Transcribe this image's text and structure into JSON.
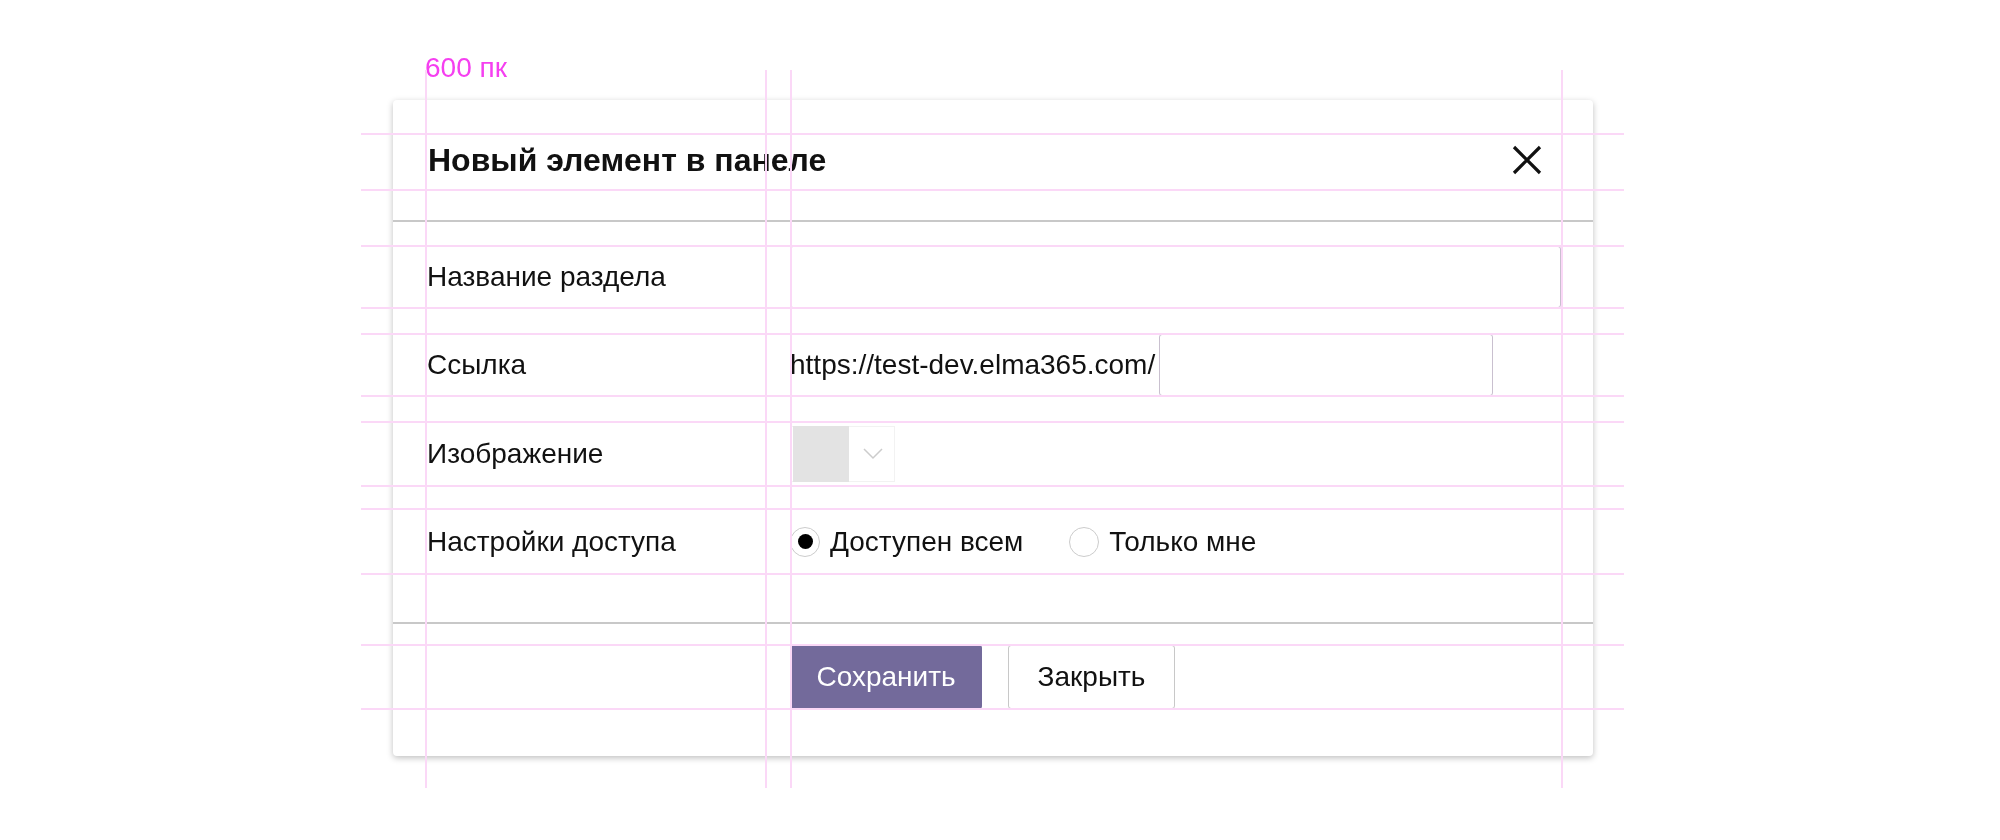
{
  "annotation": {
    "text": "600 пк"
  },
  "dialog": {
    "title": "Новый элемент в панеле",
    "fields": [
      {
        "kind": "text",
        "label": "Название раздела"
      },
      {
        "kind": "prefixed",
        "label": "Ссылка",
        "prefix": "https://test-dev.elma365.com/"
      },
      {
        "kind": "image",
        "label": "Изображение"
      },
      {
        "kind": "radio",
        "label": "Настройки доступа",
        "options": [
          {
            "label": "Доступен всем",
            "selected": true
          },
          {
            "label": "Только мне",
            "selected": false
          }
        ]
      }
    ],
    "buttons": [
      {
        "label": "Сохранить",
        "kind": "primary"
      },
      {
        "label": "Закрыть",
        "kind": "secondary"
      }
    ]
  }
}
